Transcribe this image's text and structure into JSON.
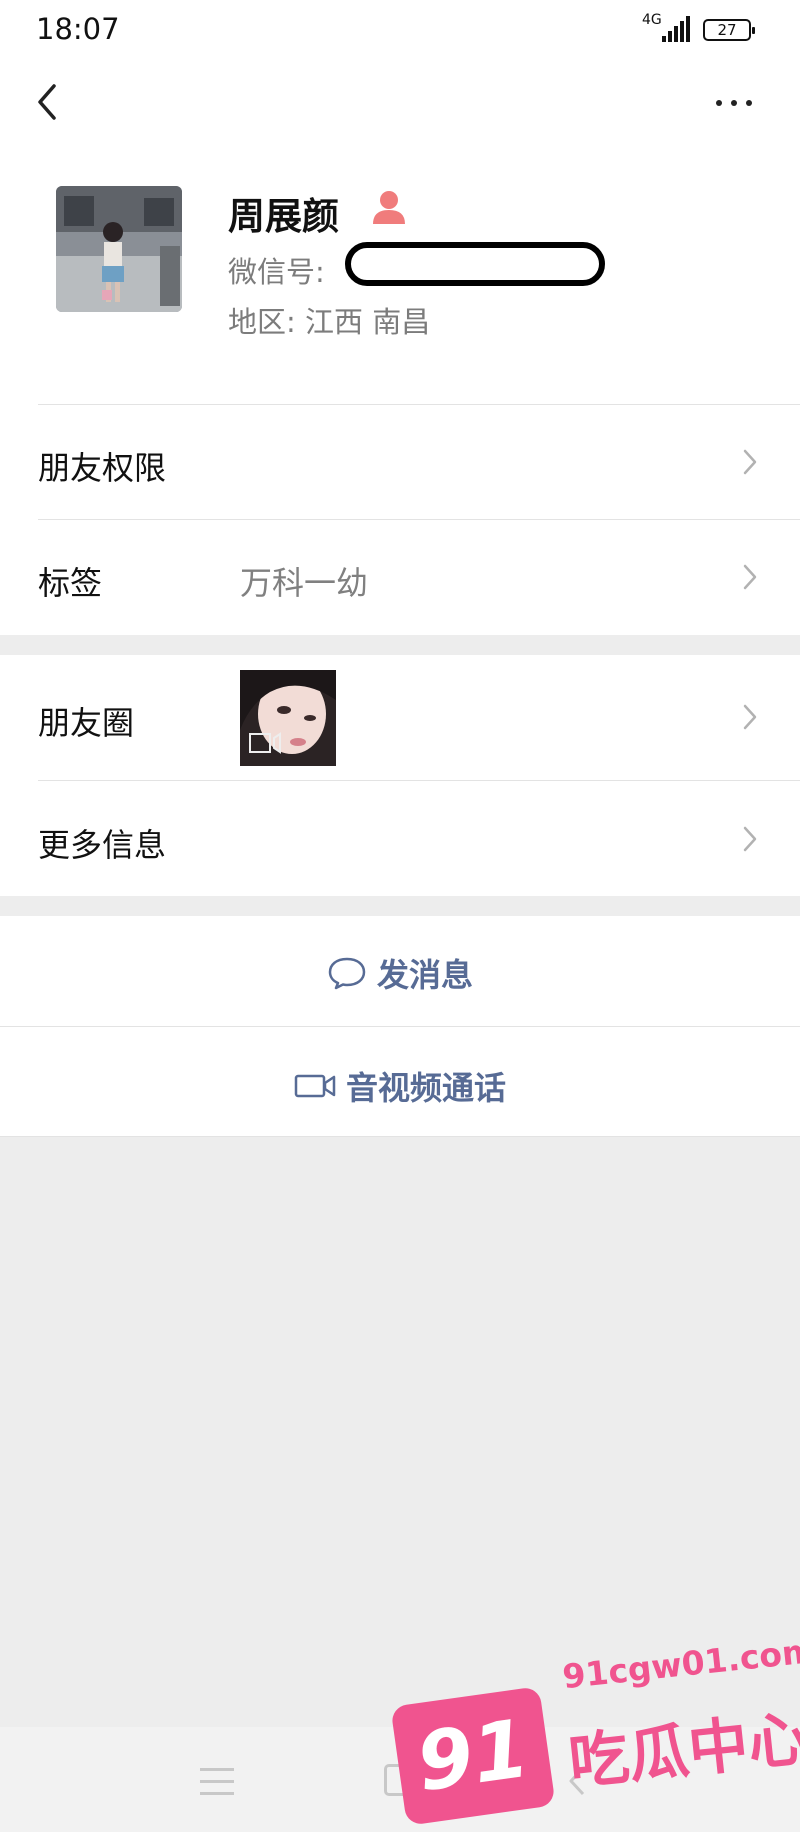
{
  "status_bar": {
    "time": "18:07",
    "network": "4G",
    "battery": "27"
  },
  "profile": {
    "name": "周展颜",
    "wechat_id_label": "微信号:",
    "region_label": "地区:",
    "region_value": "江西 南昌"
  },
  "rows": {
    "friend_permissions": "朋友权限",
    "tags_label": "标签",
    "tags_value": "万科一幼",
    "moments_label": "朋友圈",
    "more_info_label": "更多信息"
  },
  "actions": {
    "send_message": "发消息",
    "video_call": "音视频通话"
  },
  "watermark": {
    "url": "91cgw01.com",
    "badge": "91",
    "text": "吃瓜中心"
  },
  "colors": {
    "action_blue": "#576b95",
    "watermark_pink": "#f0548f",
    "background_gray": "#ededed"
  }
}
